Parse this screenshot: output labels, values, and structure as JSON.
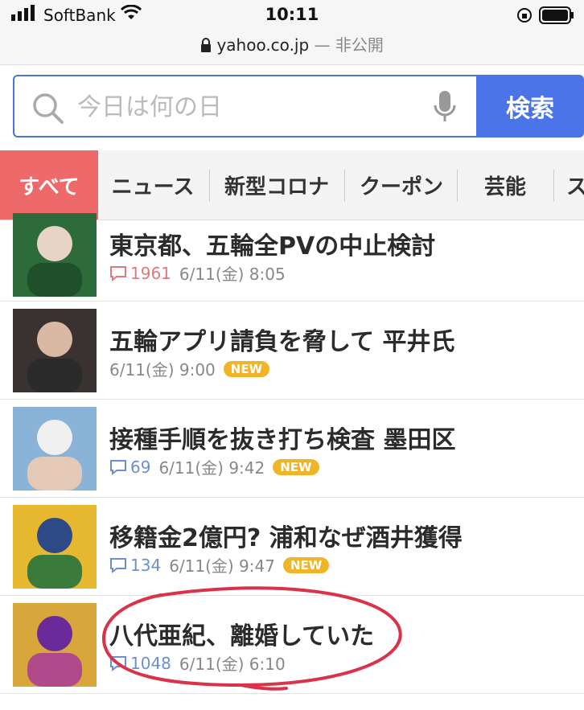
{
  "status_bar": {
    "carrier": "SoftBank",
    "time": "10:11",
    "url": "yahoo.co.jp",
    "url_suffix": "— 非公開"
  },
  "search": {
    "placeholder": "今日は何の日",
    "button_label": "検索"
  },
  "tabs": [
    "すべて",
    "ニュース",
    "新型コロナ",
    "クーポン",
    "芸能",
    "ス"
  ],
  "news": [
    {
      "title": "東京都、五輪全PVの中止検討",
      "comments": "1961",
      "date": "6/11(金) 8:05",
      "badge": "",
      "comment_color": "#e07a7a"
    },
    {
      "title": "五輪アプリ請負を脅して 平井氏",
      "comments": "",
      "date": "6/11(金) 9:00",
      "badge": "NEW",
      "comment_color": "#6b8fd6"
    },
    {
      "title": "接種手順を抜き打ち検査 墨田区",
      "comments": "69",
      "date": "6/11(金) 9:42",
      "badge": "NEW",
      "comment_color": "#6b8fd6"
    },
    {
      "title": "移籍金2億円? 浦和なぜ酒井獲得",
      "comments": "134",
      "date": "6/11(金) 9:47",
      "badge": "NEW",
      "comment_color": "#6b8fd6"
    },
    {
      "title": "八代亜紀、離婚していた",
      "comments": "1048",
      "date": "6/11(金) 6:10",
      "badge": "",
      "comment_color": "#6b8fd6"
    }
  ],
  "colors": {
    "accent": "#4a74e8",
    "active_tab": "#ee6a6a",
    "badge": "#f0b429",
    "annotation": "#d9334a"
  }
}
